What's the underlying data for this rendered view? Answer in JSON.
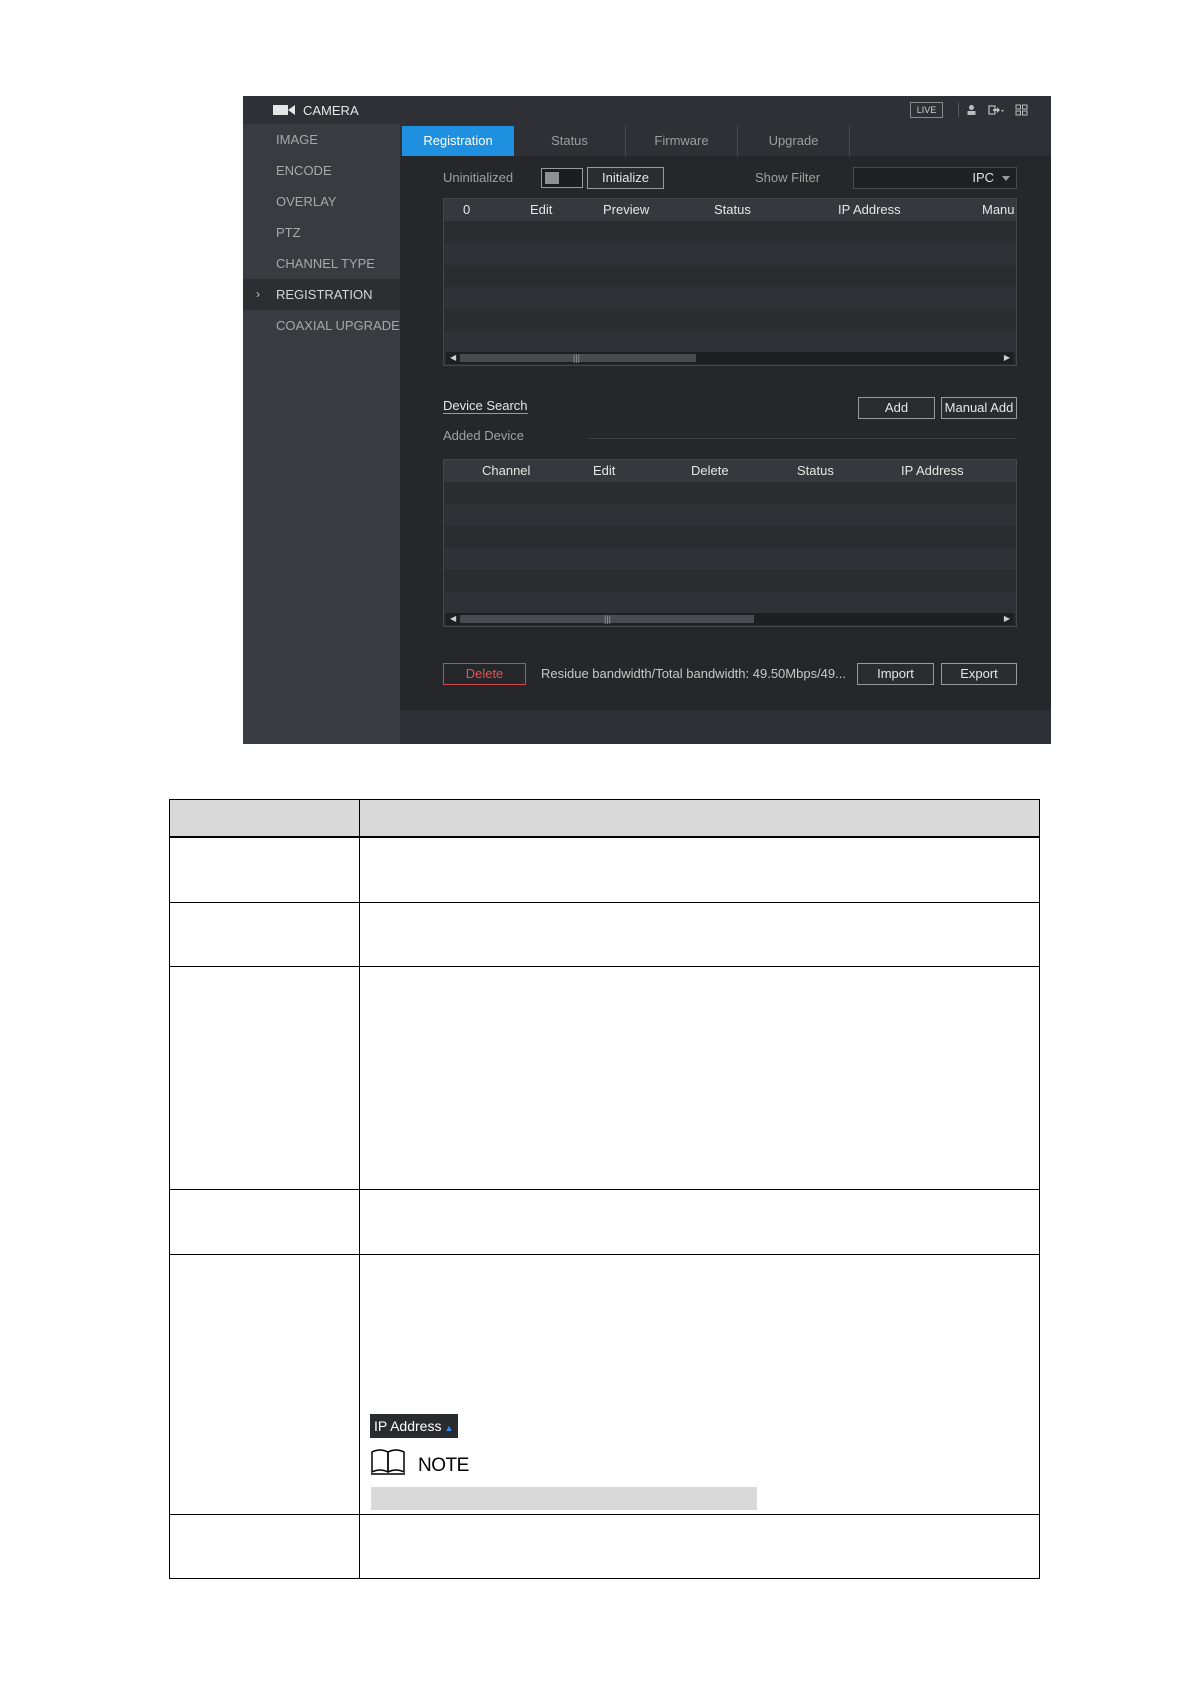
{
  "window": {
    "title": "CAMERA",
    "live_label": "LIVE",
    "icons": [
      "user-icon",
      "logout-icon",
      "grid-icon"
    ]
  },
  "sidebar": {
    "items": [
      {
        "label": "IMAGE"
      },
      {
        "label": "ENCODE"
      },
      {
        "label": "OVERLAY"
      },
      {
        "label": "PTZ"
      },
      {
        "label": "CHANNEL TYPE"
      },
      {
        "label": "REGISTRATION",
        "active": true
      },
      {
        "label": "COAXIAL UPGRADE"
      }
    ]
  },
  "tabs": [
    {
      "label": "Registration",
      "active": true
    },
    {
      "label": "Status"
    },
    {
      "label": "Firmware"
    },
    {
      "label": "Upgrade"
    }
  ],
  "controls": {
    "uninitialized_label": "Uninitialized",
    "initialize_button": "Initialize",
    "show_filter_label": "Show Filter",
    "filter_value": "IPC"
  },
  "search_table": {
    "columns": [
      "0",
      "Edit",
      "Preview",
      "Status",
      "IP Address",
      "Manu"
    ]
  },
  "actions": {
    "device_search": "Device Search",
    "add": "Add",
    "manual_add": "Manual Add",
    "added_device_label": "Added Device"
  },
  "added_table": {
    "columns": [
      "Channel",
      "Edit",
      "Delete",
      "Status",
      "IP Address"
    ]
  },
  "footer": {
    "delete": "Delete",
    "bandwidth": "Residue bandwidth/Total bandwidth:  49.50Mbps/49...",
    "import": "Import",
    "export": "Export"
  },
  "doc": {
    "ip_address_chip": "IP Address",
    "note_label": "NOTE"
  },
  "colors": {
    "accent": "#1f8fe0",
    "delete": "#e05555",
    "panel_bg": "#26272b"
  }
}
